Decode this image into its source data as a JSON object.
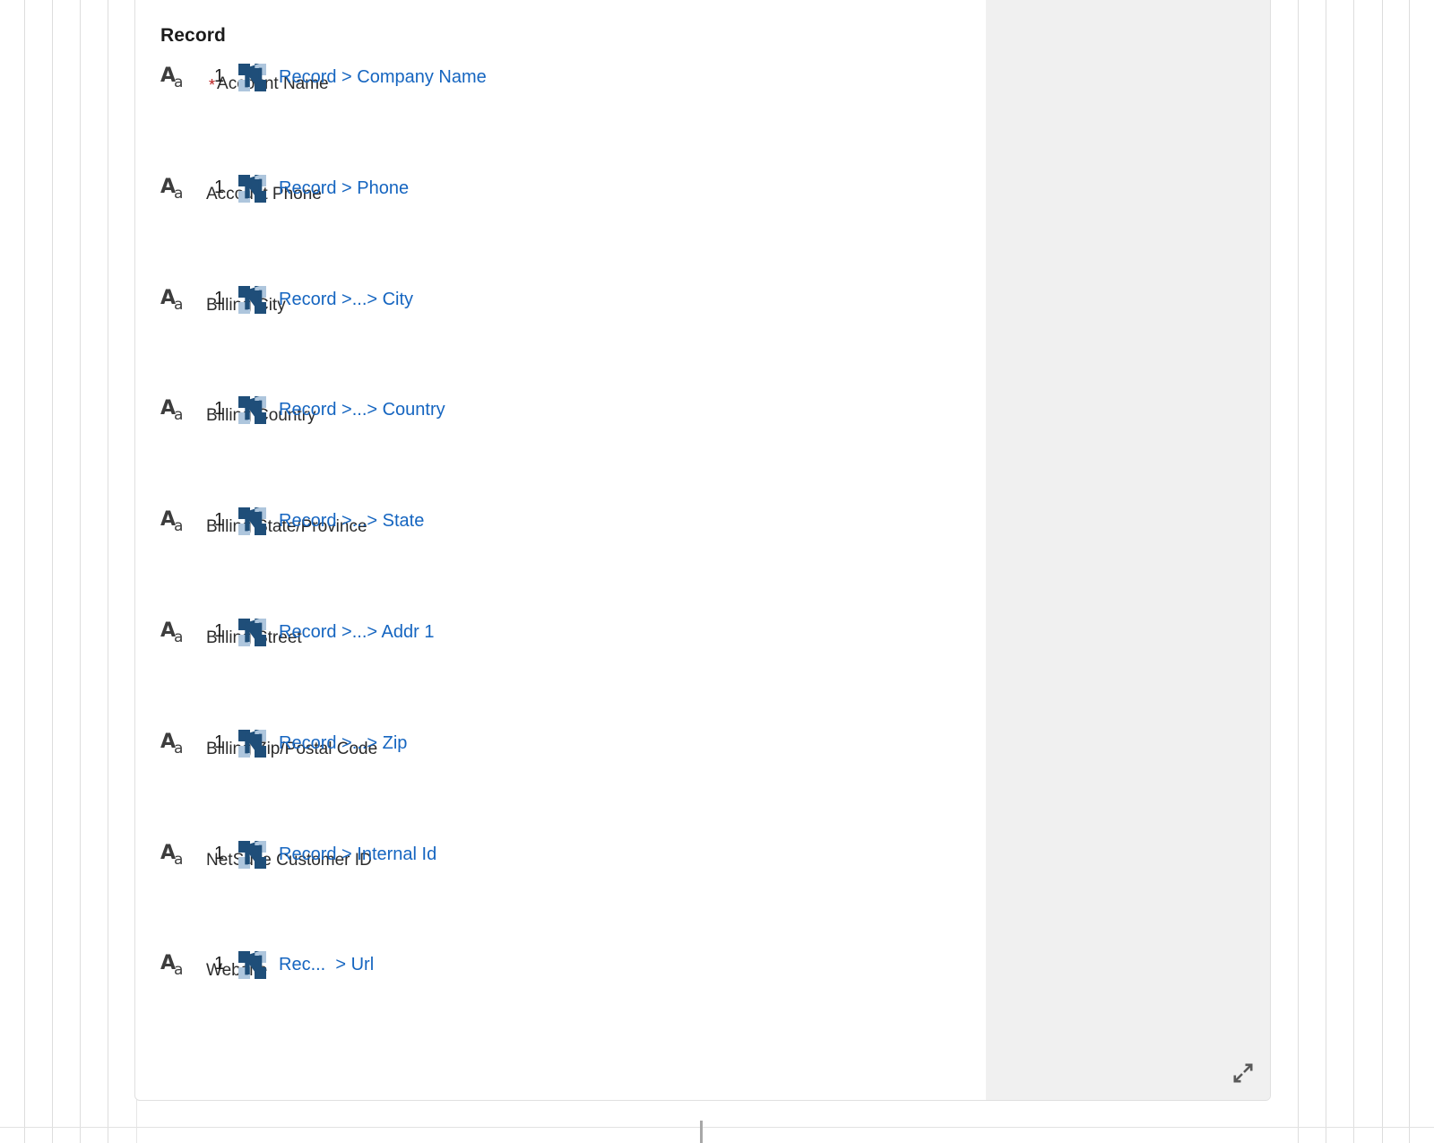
{
  "card": {
    "title": "Record",
    "expand_icon": "expand-diagonal-icon"
  },
  "icons": {
    "text_type": "Aa",
    "netsuite": "netsuite-logo-icon"
  },
  "colors": {
    "link": "#1565c0",
    "required_star": "#b91c1c",
    "label_text": "#2b2b2b",
    "title_text": "#1b1b1b",
    "card_bg": "#ffffff",
    "gutter_bg": "#f0f0f0",
    "card_border": "#e0e0e0",
    "netsuite_dark": "#1f4e79",
    "netsuite_light": "#aec6dd"
  },
  "fields": [
    {
      "label": "Account Name",
      "required": true,
      "required_marker": "*",
      "type_icon": "Aa",
      "sequence": "1",
      "source_icon": "netsuite-logo-icon",
      "mapping": "Record > Company Name"
    },
    {
      "label": "Account Phone",
      "required": false,
      "required_marker": "",
      "type_icon": "Aa",
      "sequence": "1",
      "source_icon": "netsuite-logo-icon",
      "mapping": "Record > Phone"
    },
    {
      "label": "Billing City",
      "required": false,
      "required_marker": "",
      "type_icon": "Aa",
      "sequence": "1",
      "source_icon": "netsuite-logo-icon",
      "mapping": "Record >...> City"
    },
    {
      "label": "Billing Country",
      "required": false,
      "required_marker": "",
      "type_icon": "Aa",
      "sequence": "1",
      "source_icon": "netsuite-logo-icon",
      "mapping": "Record >...> Country"
    },
    {
      "label": "Billing State/Province",
      "required": false,
      "required_marker": "",
      "type_icon": "Aa",
      "sequence": "1",
      "source_icon": "netsuite-logo-icon",
      "mapping": "Record >...> State"
    },
    {
      "label": "Billing Street",
      "required": false,
      "required_marker": "",
      "type_icon": "Aa",
      "sequence": "1",
      "source_icon": "netsuite-logo-icon",
      "mapping": "Record >...> Addr 1"
    },
    {
      "label": "Billing Zip/Postal Code",
      "required": false,
      "required_marker": "",
      "type_icon": "Aa",
      "sequence": "1",
      "source_icon": "netsuite-logo-icon",
      "mapping": "Record >...> Zip"
    },
    {
      "label": "NetSuite Customer ID",
      "required": false,
      "required_marker": "",
      "type_icon": "Aa",
      "sequence": "1",
      "source_icon": "netsuite-logo-icon",
      "mapping": "Record > Internal Id"
    },
    {
      "label": "Website",
      "required": false,
      "required_marker": "",
      "type_icon": "Aa",
      "sequence": "1",
      "source_icon": "netsuite-logo-icon",
      "mapping": "Rec...  > Url"
    }
  ]
}
